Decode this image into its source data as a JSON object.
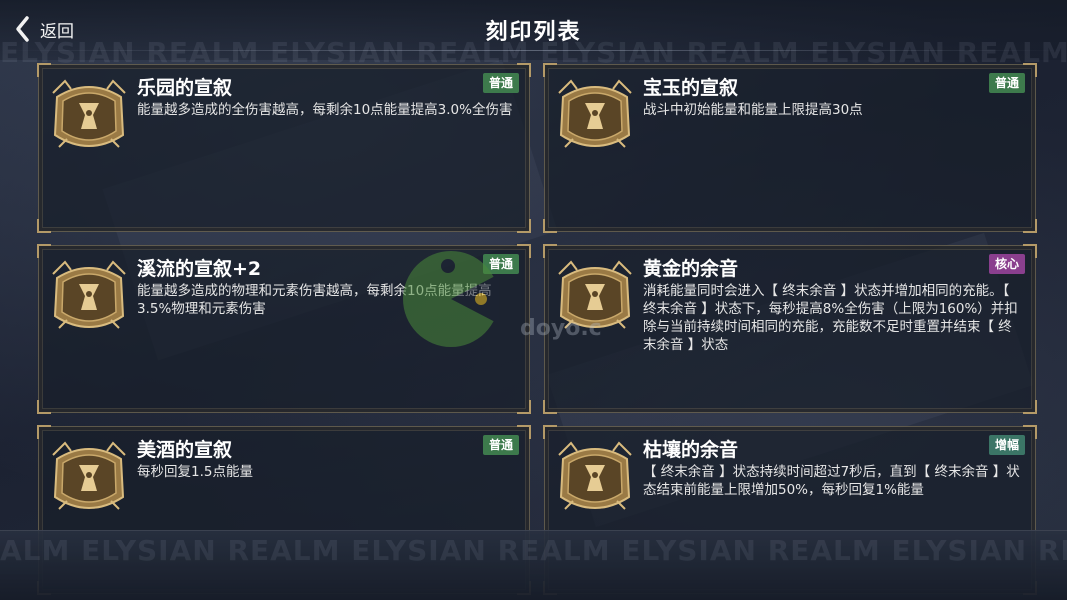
{
  "header": {
    "back_label": "返回",
    "title": "刻印列表"
  },
  "watermark": {
    "top": "ELYSIAN REALM  ELYSIAN REALM  ELYSIAN REALM  ELYSIAN REALM",
    "bottom": "ALM   ELYSIAN REALM   ELYSIAN REALM   ELYSIAN REALM   ELYSIAN REALM   ELYSIAN"
  },
  "overlay": {
    "site_text": "doyo.c"
  },
  "badge_colors": {
    "普通": "#3d7a4c",
    "核心": "#8a3f8e",
    "增幅": "#3b7566"
  },
  "cards": [
    {
      "title": "乐园的宣叙",
      "badge": "普通",
      "desc": "能量越多造成的全伤害越高，每剩余10点能量提高3.0%全伤害"
    },
    {
      "title": "宝玉的宣叙",
      "badge": "普通",
      "desc": "战斗中初始能量和能量上限提高30点"
    },
    {
      "title": "溪流的宣叙+2",
      "badge": "普通",
      "desc": "能量越多造成的物理和元素伤害越高，每剩余10点能量提高3.5%物理和元素伤害"
    },
    {
      "title": "黄金的余音",
      "badge": "核心",
      "desc": "消耗能量同时会进入【 终末余音 】状态并增加相同的充能。【 终末余音 】状态下，每秒提高8%全伤害（上限为160%）并扣除与当前持续时间相同的充能，充能数不足时重置并结束【 终末余音 】状态"
    },
    {
      "title": "美酒的宣叙",
      "badge": "普通",
      "desc": "每秒回复1.5点能量"
    },
    {
      "title": "枯壤的余音",
      "badge": "增幅",
      "desc": "【 终末余音 】状态持续时间超过7秒后，直到【 终末余音 】状态结束前能量上限增加50%，每秒回复1%能量"
    }
  ]
}
